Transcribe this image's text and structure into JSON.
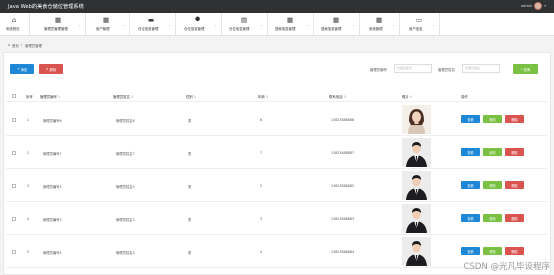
{
  "topbar": {
    "title": "Java Web的美食仓储位管理系统",
    "user_name": "admin",
    "caret": "▾"
  },
  "nav": [
    {
      "label": "系统首页",
      "icon": "home-icon",
      "glyph": "⌂"
    },
    {
      "label": "管理员管理管理",
      "icon": "grid-icon",
      "glyph": "▦"
    },
    {
      "label": "用户管理",
      "icon": "grid-icon",
      "glyph": "▦"
    },
    {
      "label": "仓位信息管理",
      "icon": "briefcase-icon",
      "glyph": "▬"
    },
    {
      "label": "仓位信息管理",
      "icon": "map-pin-icon",
      "glyph": "⬤"
    },
    {
      "label": "仓位信息管理",
      "icon": "chart-icon",
      "glyph": "▤"
    },
    {
      "label": "搜索信息管理",
      "icon": "grid-icon",
      "glyph": "▦"
    },
    {
      "label": "搜索信息管理",
      "icon": "grid-icon",
      "glyph": "▦"
    },
    {
      "label": "系统管理",
      "icon": "grid-icon",
      "glyph": "▦"
    },
    {
      "label": "用户信息",
      "icon": "window-icon",
      "glyph": "▭"
    }
  ],
  "breadcrumb": {
    "home": "首页",
    "sep": "/",
    "current": "管理员管理"
  },
  "toolbar": {
    "add_label": "添加",
    "delete_label": "删除",
    "search_label_1": "管理员编号",
    "search_placeholder_1": "管理员编号",
    "search_label_2": "管理员姓名",
    "search_placeholder_2": "管理员姓名",
    "search_button": "查询"
  },
  "table": {
    "headers": [
      "序号",
      "管理员编号",
      "管理员姓名",
      "性别",
      "年龄",
      "联系电话",
      "照片",
      "操作"
    ],
    "sort_glyph": "⇅",
    "rows": [
      {
        "index": "1",
        "code": "管理员编号6",
        "name": "管理员姓名6",
        "gender": "男",
        "age": "6",
        "phone": "13823888886",
        "photo": "female"
      },
      {
        "index": "2",
        "code": "管理员编号7",
        "name": "管理员姓名7",
        "gender": "男",
        "age": "7",
        "phone": "13823888887",
        "photo": "male"
      },
      {
        "index": "3",
        "code": "管理员编号5",
        "name": "管理员姓名5",
        "gender": "男",
        "age": "5",
        "phone": "13823888885",
        "photo": "male"
      },
      {
        "index": "4",
        "code": "管理员编号3",
        "name": "管理员姓名3",
        "gender": "男",
        "age": "3",
        "phone": "13823888883",
        "photo": "male"
      },
      {
        "index": "5",
        "code": "管理员编号4",
        "name": "管理员姓名4",
        "gender": "男",
        "age": "4",
        "phone": "13823888884",
        "photo": "male"
      }
    ],
    "actions": {
      "view": "查看",
      "edit": "修改",
      "delete": "删除"
    }
  },
  "watermark": "CSDN @光凡毕设程序",
  "colors": {
    "primary": "#1e88d7",
    "success": "#7ac143",
    "danger": "#d9534f",
    "topbar": "#2f3133"
  }
}
